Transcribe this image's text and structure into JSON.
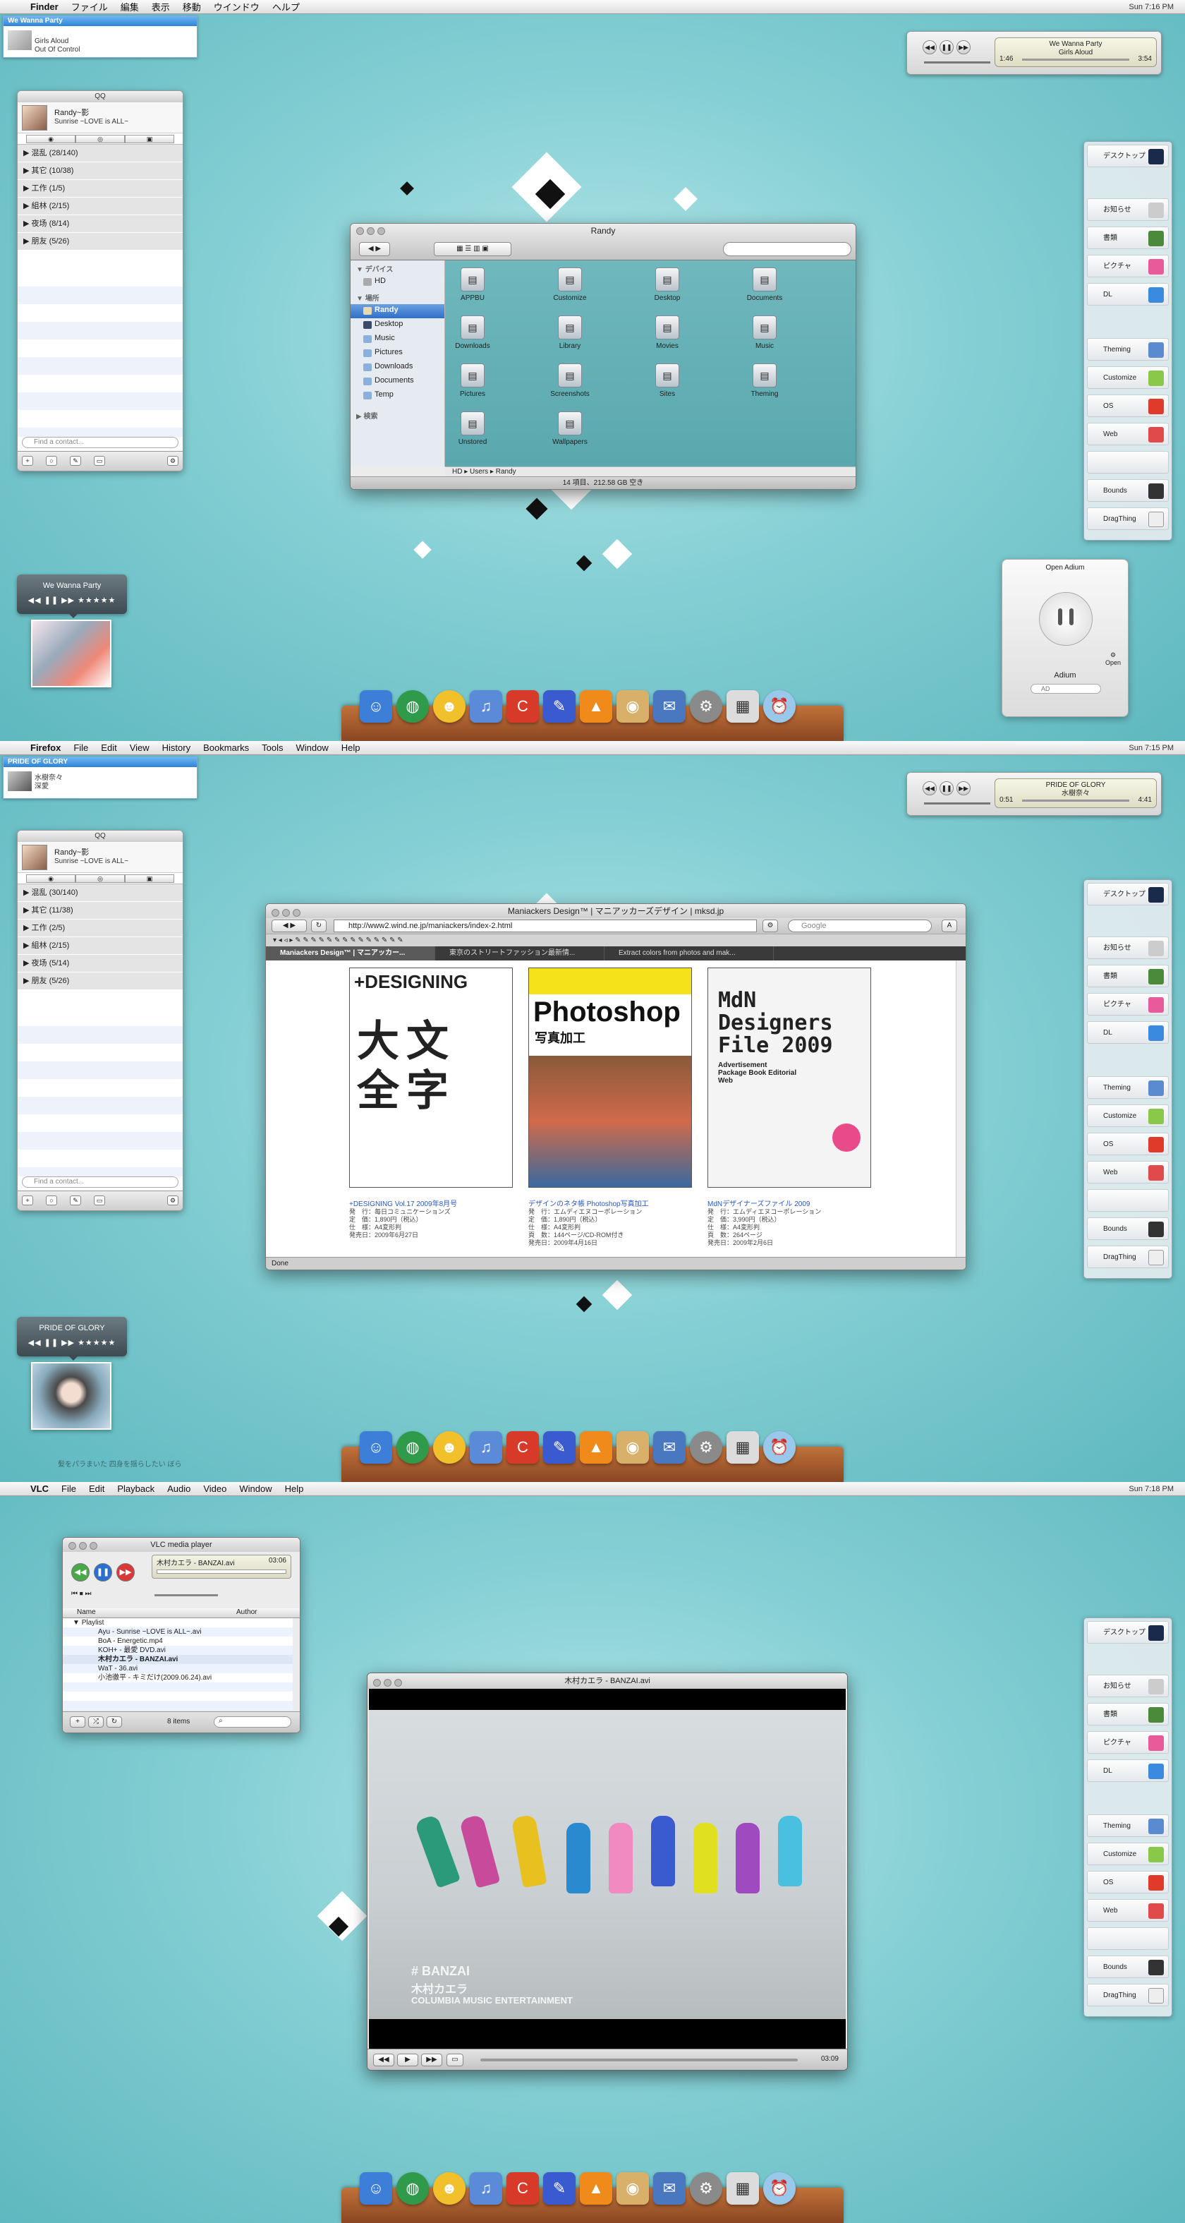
{
  "screens": [
    {
      "menubar": {
        "app": "Finder",
        "items": [
          "ファイル",
          "編集",
          "表示",
          "移動",
          "ウインドウ",
          "ヘルプ"
        ],
        "clock": "Sun 7:16 PM"
      },
      "growl": {
        "title": "We Wanna Party",
        "line1": "Girls Aloud",
        "line2": "Out Of Control"
      },
      "itunes": {
        "song": "We Wanna Party",
        "artist": "Girls Aloud",
        "elapsed": "1:46",
        "remaining": "3:54"
      },
      "mini_player": {
        "title": "We Wanna Party",
        "controls": "◀◀ ❚❚ ▶▶ ★★★★★"
      }
    },
    {
      "menubar": {
        "app": "Firefox",
        "items": [
          "File",
          "Edit",
          "View",
          "History",
          "Bookmarks",
          "Tools",
          "Window",
          "Help"
        ],
        "clock": "Sun 7:15 PM"
      },
      "growl": {
        "title": "PRIDE OF GLORY",
        "line1": "水樹奈々",
        "line2": "深愛"
      },
      "itunes": {
        "song": "PRIDE OF GLORY",
        "artist": "水樹奈々",
        "elapsed": "0:51",
        "remaining": "4:41"
      },
      "mini_player": {
        "title": "PRIDE OF GLORY",
        "controls": "◀◀ ❚❚ ▶▶ ★★★★★"
      },
      "caption": "髪をパラまいた 四身を揺らしたい ぼら"
    },
    {
      "menubar": {
        "app": "VLC",
        "items": [
          "File",
          "Edit",
          "Playback",
          "Audio",
          "Video",
          "Window",
          "Help"
        ],
        "clock": "Sun 7:18 PM"
      }
    }
  ],
  "qq": {
    "title": "QQ",
    "user": "Randy~影",
    "status": "Sunrise ~LOVE is ALL~",
    "groups_1": [
      "混乱 (28/140)",
      "其它 (10/38)",
      "工作 (1/5)",
      "組林 (2/15)",
      "夜场 (8/14)",
      "朋友 (5/26)"
    ],
    "groups_2": [
      "混乱 (30/140)",
      "其它 (11/38)",
      "工作 (2/5)",
      "組林 (2/15)",
      "夜场 (5/14)",
      "朋友 (5/26)"
    ],
    "find_placeholder": "Find a contact..."
  },
  "sidebar": {
    "items": [
      "デスクトップ",
      "お知らせ",
      "書類",
      "ピクチャ",
      "DL",
      "Theming",
      "Customize",
      "OS",
      "Web",
      "Bounds",
      "DragThing"
    ]
  },
  "finder": {
    "title": "Randy",
    "search_placeholder": "",
    "sidebar_heads": [
      "デバイス",
      "場所",
      "検索"
    ],
    "devices": [
      "HD"
    ],
    "places": [
      "Randy",
      "Desktop",
      "Music",
      "Pictures",
      "Downloads",
      "Documents",
      "Temp"
    ],
    "icons": [
      "APPBU",
      "Customize",
      "Desktop",
      "Documents",
      "Downloads",
      "Library",
      "Movies",
      "Music",
      "Pictures",
      "Screenshots",
      "Sites",
      "Theming",
      "Unstored",
      "Wallpapers"
    ],
    "path": [
      "HD",
      "Users",
      "Randy"
    ],
    "status": "14 項目、212.58 GB 空き"
  },
  "adium": {
    "title": "Open Adium",
    "name": "Adium",
    "field": "AD",
    "open": "Open"
  },
  "dock": {
    "icons": [
      "finder",
      "earth",
      "adium",
      "itunes",
      "cog",
      "pen",
      "vlc",
      "owl",
      "mail",
      "gear",
      "preview",
      "alarm"
    ]
  },
  "firefox": {
    "title": "Maniackers Design™ | マニアッカーズデザイン | mksd.jp",
    "url": "http://www2.wind.ne.jp/maniackers/index-2.html",
    "search": "Google",
    "tabs": [
      "Maniackers Design™ | マニアッカー...",
      "東京のストリートファッション最新情...",
      "Extract colors from photos and mak..."
    ],
    "status": "Done",
    "books": [
      {
        "cover_title": "+DESIGNING",
        "cover_kanji": "大文全字",
        "link": "+DESIGNING Vol.17 2009年8月号",
        "lines": [
          "発　行：毎日コミュニケーションズ",
          "定　価：1,890円（税込）",
          "仕　様：A4変形判",
          "発売日：2009年6月27日"
        ]
      },
      {
        "cover_title": "Photoshop",
        "cover_sub": "写真加工",
        "link": "デザインのネタ帳 Photoshop写真加工",
        "lines": [
          "発　行：エムディエヌコーポレーション",
          "定　価：1,890円（税込）",
          "仕　様：A4変形判",
          "頁　数：144ページ/CD-ROM付き",
          "発売日：2009年4月16日"
        ]
      },
      {
        "cover_title": "MdN Designers File 2009",
        "cover_sub": "Advertisement Package Book Editorial Web",
        "link": "MdNデザイナーズファイル 2009",
        "lines": [
          "発　行：エムディエヌコーポレーション",
          "定　価：3,990円（税込）",
          "仕　様：A4変形判",
          "頁　数：264ページ",
          "発売日：2009年2月6日"
        ]
      }
    ]
  },
  "vlc": {
    "title": "VLC media player",
    "now": "木村カエラ - BANZAI.avi",
    "time": "03:06",
    "cols": [
      "Name",
      "Author"
    ],
    "playlist_label": "Playlist",
    "playlist": [
      "Ayu - Sunrise ~LOVE is ALL~.avi",
      "BoA - Energetic.mp4",
      "KOH+ - 最愛 DVD.avi",
      "木村カエラ - BANZAI.avi",
      "WaT - 36.avi",
      "小池徹平 - キミだけ(2009.06.24).avi"
    ],
    "count": "8 items",
    "video_title": "木村カエラ - BANZAI.avi",
    "video_time": "03:09",
    "caption1": "# BANZAI",
    "caption2": "木村カエラ",
    "caption3": "COLUMBIA MUSIC ENTERTAINMENT"
  },
  "colors": {
    "accent": "#2e6fc9",
    "wallpaper": "#7ecfd4",
    "dock_shelf": "#a85a2c"
  }
}
